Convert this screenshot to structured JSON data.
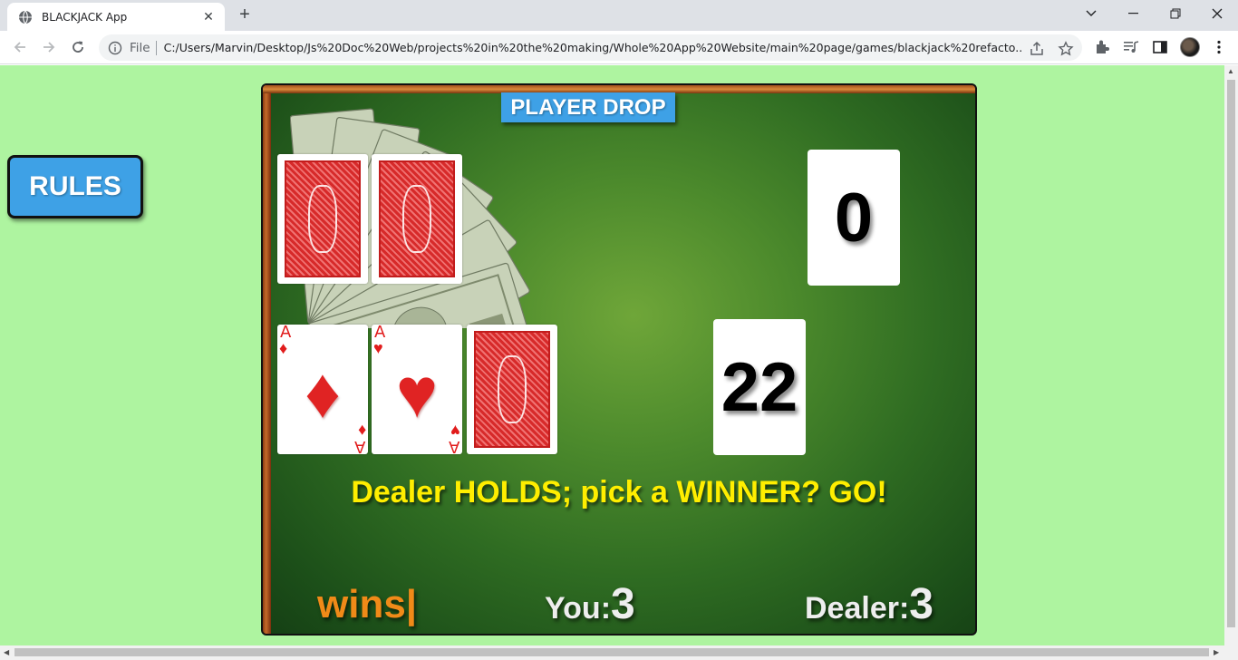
{
  "browser": {
    "tab_title": "BLACKJACK App",
    "scheme_label": "File",
    "url": "C:/Users/Marvin/Desktop/Js%20Doc%20Web/projects%20in%20the%20making/Whole%20App%20Website/main%20page/games/blackjack%20refacto..."
  },
  "page": {
    "background_color": "#aef4a0",
    "rules_label": "RULES"
  },
  "game": {
    "drop_label": "PLAYER DROP",
    "dealer_hand": [
      {
        "face": "back"
      },
      {
        "face": "back"
      }
    ],
    "player_hand": [
      {
        "face": "up",
        "rank": "A",
        "suit": "diamonds",
        "suit_symbol": "♦"
      },
      {
        "face": "up",
        "rank": "A",
        "suit": "hearts",
        "suit_symbol": "♥"
      },
      {
        "face": "back"
      }
    ],
    "dealer_score": "0",
    "player_score": "22",
    "status_message": "Dealer HOLDS; pick a WINNER? GO!",
    "wins_label": "wins|",
    "you_label": "You:",
    "you_wins": "3",
    "dealer_label": "Dealer:",
    "dealer_wins": "3"
  },
  "icons": [
    "globe-icon",
    "close-icon",
    "new-tab-icon",
    "back-icon",
    "forward-icon",
    "reload-icon",
    "info-icon",
    "share-icon",
    "bookmark-star-icon",
    "extensions-icon",
    "media-icon",
    "side-panel-icon",
    "menu-icon",
    "money-fan-icon"
  ]
}
